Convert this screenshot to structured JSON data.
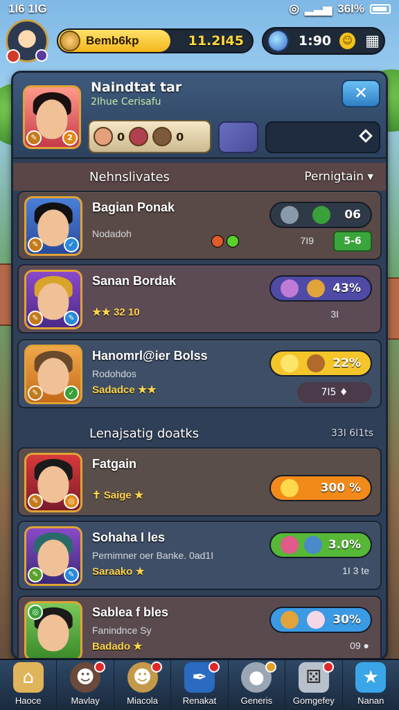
{
  "status_bar": {
    "time": "1I6 1IG",
    "battery": "36I%"
  },
  "hud": {
    "xp_label": "Bemb6kp",
    "xp_value": "11.2I45",
    "xp_fill": 0.58,
    "timer": "1:90",
    "menu_icon": "grid-icon"
  },
  "profile": {
    "name": "Naindtat tar",
    "subtitle": "2Ihue Cerisafu",
    "ingredients": [
      "0",
      "0"
    ],
    "close_label": "✕",
    "level_badge": "2"
  },
  "section1": {
    "title": "Nehnslivates",
    "right": "Pernigtain ▾"
  },
  "section2": {
    "title": "Lenajsatig doatks",
    "right": "33I  6I1ts"
  },
  "rows": [
    {
      "name": "Bagian Ponak",
      "sub": "Nodadoh",
      "tag": "",
      "pill": "06",
      "meta": "7I9",
      "meta2": "5-6",
      "pill_color": "#2f3a48"
    },
    {
      "name": "Sanan Bordak",
      "sub": "",
      "tag": "★★ 32 10",
      "pill": "43%",
      "meta": "3I",
      "meta2": "",
      "pill_color": "#4f4aa6"
    },
    {
      "name": "Hanomrl@ier Bolss",
      "sub": "Rodohdos",
      "tag": "Sadadce ★★",
      "pill": "22%",
      "meta": "7I5 ♦",
      "meta2": "",
      "pill_color": "#f4c52a"
    },
    {
      "name": "Fatgain",
      "sub": "",
      "tag": "✝ Saige ★",
      "pill": "300 %",
      "meta": "",
      "meta2": "",
      "pill_color": "#f28a1a"
    },
    {
      "name": "Sohaha I les",
      "sub": "Pernimner oer Banke. 0ad1I",
      "tag": "Saraako ★",
      "pill": "3.0%",
      "meta": "1I   3 te",
      "meta2": "",
      "pill_color": "#56b836"
    },
    {
      "name": "Sablea f bles",
      "sub": "Fanindnce Sy",
      "tag": "Badado ★",
      "pill": "30%",
      "meta": "09 ●",
      "meta2": "",
      "pill_color": "#3a9ae4"
    }
  ],
  "bottom_nav": [
    {
      "label": "Haoce",
      "icon": "home-icon"
    },
    {
      "label": "Mavlay",
      "icon": "portrait-icon"
    },
    {
      "label": "Miacola",
      "icon": "portrait-icon"
    },
    {
      "label": "Renakat",
      "icon": "cannon-icon"
    },
    {
      "label": "Generis",
      "icon": "pin-icon"
    },
    {
      "label": "Gomgefey",
      "icon": "dice-icon"
    },
    {
      "label": "Nanan",
      "icon": "star-icon"
    }
  ]
}
